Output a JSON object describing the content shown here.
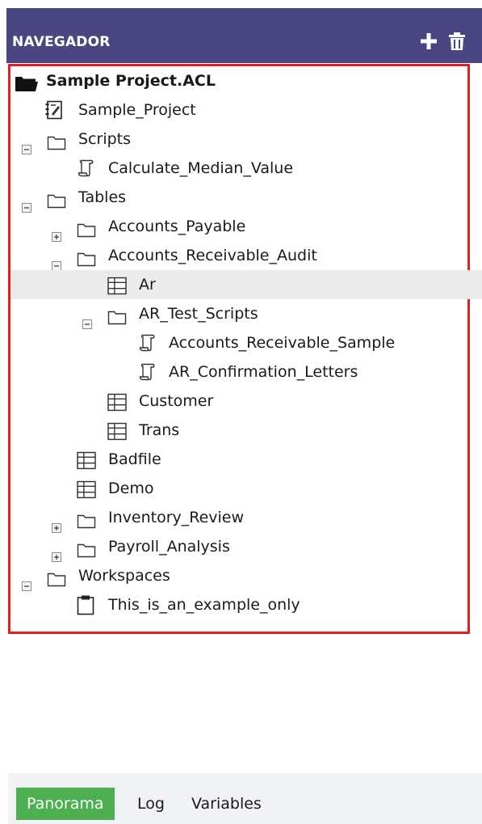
{
  "header": {
    "title": "NAVEGADOR",
    "add_icon": "plus-icon",
    "delete_icon": "trash-icon"
  },
  "tree": {
    "root": "Sample Project.ACL",
    "sample_project": "Sample_Project",
    "scripts": "Scripts",
    "calculate_median_value": "Calculate_Median_Value",
    "tables": "Tables",
    "accounts_payable": "Accounts_Payable",
    "accounts_receivable_audit": "Accounts_Receivable_Audit",
    "ar": "Ar",
    "ar_test_scripts": "AR_Test_Scripts",
    "accounts_receivable_sample": "Accounts_Receivable_Sample",
    "ar_confirmation_letters": "AR_Confirmation_Letters",
    "customer": "Customer",
    "trans": "Trans",
    "badfile": "Badfile",
    "demo": "Demo",
    "inventory_review": "Inventory_Review",
    "payroll_analysis": "Payroll_Analysis",
    "workspaces": "Workspaces",
    "this_is_an_example_only": "This_is_an_example_only"
  },
  "footer": {
    "tabs": [
      "Panorama",
      "Log",
      "Variables"
    ],
    "active": "Panorama"
  },
  "colors": {
    "header_bg": "#4a4682",
    "highlight_border": "#e02020",
    "active_tab": "#4caf50",
    "selected_row": "#ebebeb"
  }
}
